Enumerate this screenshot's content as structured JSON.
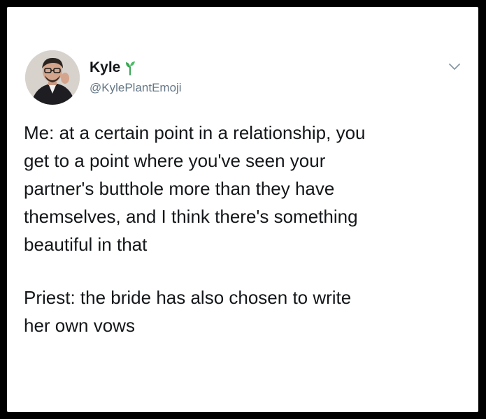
{
  "tweet": {
    "author": {
      "display_name": "Kyle",
      "handle": "@KylePlantEmoji",
      "badge_icon": "sprout-icon",
      "avatar_icon": "avatar"
    },
    "menu_icon": "chevron-down-icon",
    "paragraphs": [
      {
        "lines": [
          "Me: at a certain point in a relationship, you",
          "get to a point where you've seen your",
          "partner's butthole more than they have",
          "themselves, and I think there's something",
          "beautiful in that"
        ]
      },
      {
        "lines": [
          "Priest: the bride has also chosen to write",
          "her own vows"
        ]
      }
    ]
  },
  "colors": {
    "frame": "#000000",
    "card": "#ffffff",
    "text": "#14171a",
    "muted": "#657786",
    "sprout": "#3aa655"
  }
}
